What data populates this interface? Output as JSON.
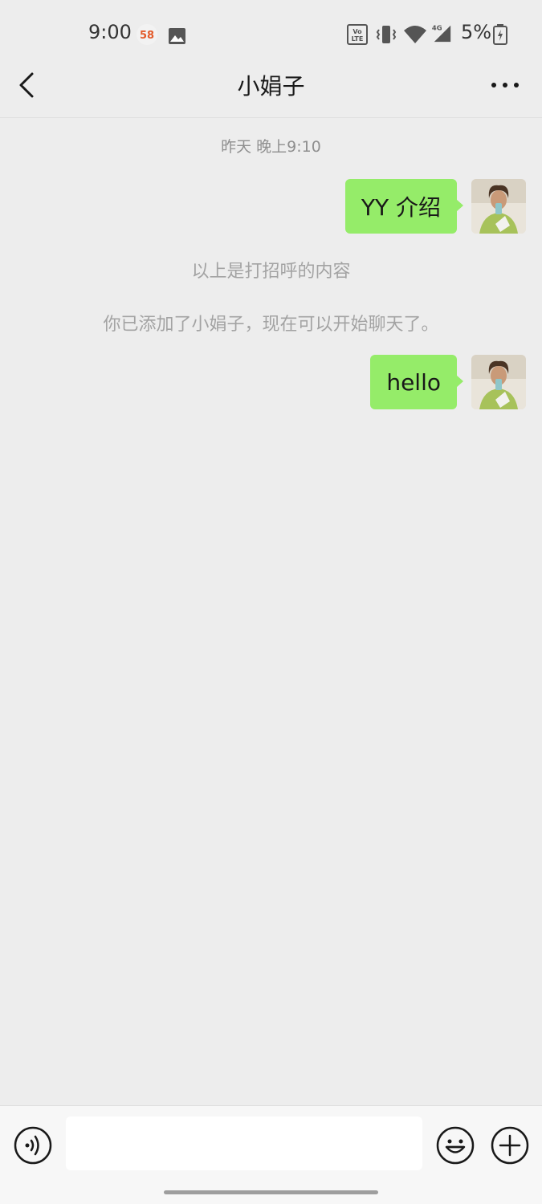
{
  "status_bar": {
    "time": "9:00",
    "app_badge_text": "58",
    "network_label": "4G",
    "volte_label": "Vo LTE",
    "battery_percent": "5%",
    "icons": [
      "58-app-icon",
      "image-icon",
      "volte-icon",
      "vibrate-icon",
      "wifi-icon",
      "cell-signal-icon",
      "battery-charging-icon"
    ]
  },
  "nav": {
    "title": "小娟子",
    "icons": [
      "back-arrow-icon",
      "more-icon"
    ]
  },
  "chat": {
    "timestamp": "昨天 晚上9:10",
    "messages": [
      {
        "text": "YY 介绍",
        "side": "right"
      },
      {
        "text": "hello",
        "side": "right"
      }
    ],
    "system_notes": [
      "以上是打招呼的内容",
      "你已添加了小娟子，现在可以开始聊天了。"
    ]
  },
  "input_bar": {
    "value": "",
    "placeholder": "",
    "icons": [
      "voice-icon",
      "emoji-icon",
      "plus-icon"
    ]
  },
  "colors": {
    "background": "#ededed",
    "bubble": "#95ec69",
    "input_bar": "#f7f7f7"
  }
}
